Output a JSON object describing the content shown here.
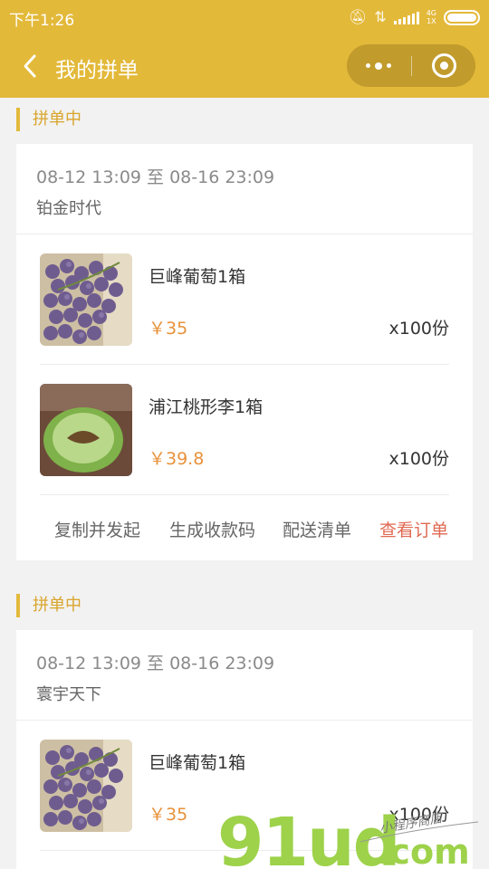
{
  "status_bar": {
    "time": "下午1:26",
    "network_label": "4G",
    "network_sub": "1X"
  },
  "nav": {
    "title": "我的拼单"
  },
  "colors": {
    "brand": "#e3b93a",
    "price": "#e8913a",
    "primary_action": "#e06a52"
  },
  "groups": [
    {
      "status_label": "拼单中",
      "date_range": "08-12 13:09 至 08-16 23:09",
      "shop_name": "铂金时代",
      "items": [
        {
          "name": "巨峰葡萄1箱",
          "price": "￥35",
          "quantity": "x100份",
          "image": "grapes-photo"
        },
        {
          "name": "浦江桃形李1箱",
          "price": "￥39.8",
          "quantity": "x100份",
          "image": "plum-photo"
        }
      ],
      "actions": [
        "复制并发起",
        "生成收款码",
        "配送清单",
        "查看订单"
      ]
    },
    {
      "status_label": "拼单中",
      "date_range": "08-12 13:09 至 08-16 23:09",
      "shop_name": "寰宇天下",
      "items": [
        {
          "name": "巨峰葡萄1箱",
          "price": "￥35",
          "quantity": "x100份",
          "image": "grapes-photo"
        }
      ]
    }
  ],
  "watermark": {
    "logo_text": "91ud",
    "domain": ".com",
    "tagline": "小程序商店"
  }
}
